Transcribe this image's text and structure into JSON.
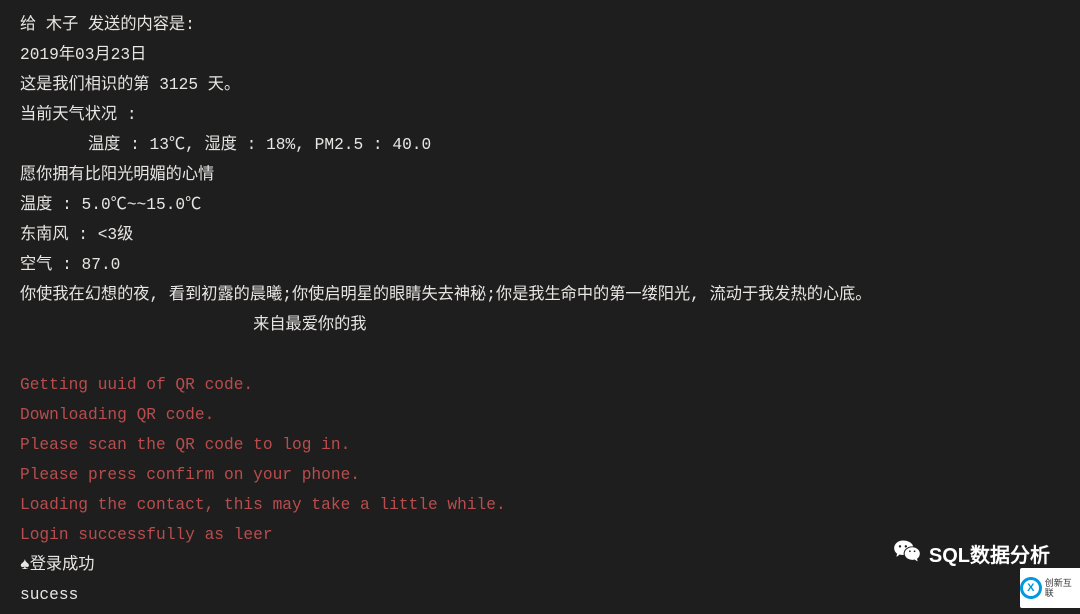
{
  "console": {
    "output_lines": [
      {
        "text": "给 木子 发送的内容是:",
        "style": "text-white"
      },
      {
        "text": "2019年03月23日",
        "style": "text-white"
      },
      {
        "text": "这是我们相识的第 3125 天。",
        "style": "text-white"
      },
      {
        "text": "当前天气状况 :",
        "style": "text-white"
      },
      {
        "text": "       温度 : 13℃, 湿度 : 18%, PM2.5 : 40.0",
        "style": "text-white"
      },
      {
        "text": "愿你拥有比阳光明媚的心情",
        "style": "text-white"
      },
      {
        "text": "温度 : 5.0℃~~15.0℃",
        "style": "text-white"
      },
      {
        "text": "东南风 : <3级",
        "style": "text-white"
      },
      {
        "text": "空气 : 87.0",
        "style": "text-white"
      },
      {
        "text": "你使我在幻想的夜, 看到初露的晨曦;你使启明星的眼睛失去神秘;你是我生命中的第一缕阳光, 流动于我发热的心底。",
        "style": "text-white"
      },
      {
        "text": "                        来自最爱你的我",
        "style": "text-white"
      },
      {
        "text": "",
        "style": "text-white"
      },
      {
        "text": "Getting uuid of QR code.",
        "style": "text-red"
      },
      {
        "text": "Downloading QR code.",
        "style": "text-red"
      },
      {
        "text": "Please scan the QR code to log in.",
        "style": "text-red"
      },
      {
        "text": "Please press confirm on your phone.",
        "style": "text-red"
      },
      {
        "text": "Loading the contact, this may take a little while.",
        "style": "text-red"
      },
      {
        "text": "Login successfully as leer",
        "style": "text-red"
      },
      {
        "text": "♠登录成功",
        "style": "text-white"
      },
      {
        "text": "sucess",
        "style": "text-white"
      }
    ]
  },
  "watermark": {
    "label": "SQL数据分析"
  },
  "partner": {
    "brand_cn": "创新互联"
  }
}
